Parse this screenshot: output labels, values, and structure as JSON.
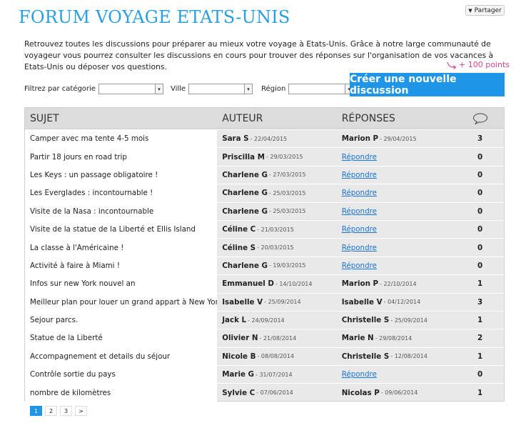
{
  "header": {
    "title": "FORUM VOYAGE ETATS-UNIS",
    "share_label": "Partager"
  },
  "intro": "Retrouvez toutes les discussions pour préparer au mieux votre voyage à Etats-Unis. Grâce à notre large communauté de voyageur vous pourrez consulter les discussions en cours pour trouver des réponses sur l'organisation de vos vacances à Etats-Unis ou déposer vos questions.",
  "points_label": "+ 100 points",
  "create_button": "Créer une nouvelle discussion",
  "filters": {
    "category_label": "Filtrez par catégorie",
    "city_label": "Ville",
    "region_label": "Région"
  },
  "table": {
    "headers": {
      "subject": "SUJET",
      "author": "AUTEUR",
      "replies": "RÉPONSES"
    },
    "rows": [
      {
        "subject": "Camper avec ma tente 4-5 mois",
        "author": "Sara S",
        "author_date": "- 22/04/2015",
        "reply_name": "Marion P",
        "reply_date": "- 29/04/2015",
        "reply_link": "",
        "count": "3"
      },
      {
        "subject": "Partir 18 jours en road trip",
        "author": "Priscilla M",
        "author_date": "- 29/03/2015",
        "reply_name": "",
        "reply_date": "",
        "reply_link": "Répondre",
        "count": "0"
      },
      {
        "subject": "Les Keys : un passage obligatoire !",
        "author": "Charlene G",
        "author_date": "- 27/03/2015",
        "reply_name": "",
        "reply_date": "",
        "reply_link": "Répondre",
        "count": "0"
      },
      {
        "subject": "Les Everglades : incontournable !",
        "author": "Charlene G",
        "author_date": "- 25/03/2015",
        "reply_name": "",
        "reply_date": "",
        "reply_link": "Répondre",
        "count": "0"
      },
      {
        "subject": "Visite de la Nasa : incontournable",
        "author": "Charlene G",
        "author_date": "- 25/03/2015",
        "reply_name": "",
        "reply_date": "",
        "reply_link": "Répondre",
        "count": "0"
      },
      {
        "subject": "Visite de la statue de la Liberté et Ellis Island",
        "author": "Céline C",
        "author_date": "- 21/03/2015",
        "reply_name": "",
        "reply_date": "",
        "reply_link": "Répondre",
        "count": "0"
      },
      {
        "subject": "La classe à l'Américaine !",
        "author": "Céline S",
        "author_date": "- 20/03/2015",
        "reply_name": "",
        "reply_date": "",
        "reply_link": "Répondre",
        "count": "0"
      },
      {
        "subject": "Activité à faire à Miami !",
        "author": "Charlene G",
        "author_date": "- 19/03/2015",
        "reply_name": "",
        "reply_date": "",
        "reply_link": "Répondre",
        "count": "0"
      },
      {
        "subject": "Infos sur new York nouvel an",
        "author": "Emmanuel D",
        "author_date": "- 14/10/2014",
        "reply_name": "Marion P",
        "reply_date": "- 22/10/2014",
        "reply_link": "",
        "count": "1"
      },
      {
        "subject": "Meilleur plan pour louer un grand appart à New York",
        "author": "Isabelle V",
        "author_date": "- 25/09/2014",
        "reply_name": "Isabelle V",
        "reply_date": "- 04/12/2014",
        "reply_link": "",
        "count": "3"
      },
      {
        "subject": "Sejour parcs.",
        "author": "Jack L",
        "author_date": "- 24/09/2014",
        "reply_name": "Christelle S",
        "reply_date": "- 25/09/2014",
        "reply_link": "",
        "count": "1"
      },
      {
        "subject": "Statue de la Liberté",
        "author": "Olivier N",
        "author_date": "- 21/08/2014",
        "reply_name": "Marie N",
        "reply_date": "- 29/08/2014",
        "reply_link": "",
        "count": "2"
      },
      {
        "subject": "Accompagnement et details du séjour",
        "author": "Nicole B",
        "author_date": "- 08/08/2014",
        "reply_name": "Christelle S",
        "reply_date": "- 12/08/2014",
        "reply_link": "",
        "count": "1"
      },
      {
        "subject": "Contrôle sortie du pays",
        "author": "Marie G",
        "author_date": "- 31/07/2014",
        "reply_name": "",
        "reply_date": "",
        "reply_link": "Répondre",
        "count": "0"
      },
      {
        "subject": "nombre de kilomètres",
        "author": "Sylvie C",
        "author_date": "- 07/06/2014",
        "reply_name": "Nicolas P",
        "reply_date": "- 09/06/2014",
        "reply_link": "",
        "count": "1"
      }
    ]
  },
  "pagination": {
    "pages": [
      "1",
      "2",
      "3"
    ],
    "active": "1",
    "next": ">"
  },
  "colors": {
    "title": "#2a9fe0",
    "create_button": "#1e95e6",
    "points": "#d9468e",
    "link": "#1a73d6"
  },
  "icons": {
    "share": "chevron-down-icon",
    "comments": "speech-bubble-icon",
    "points_arrow": "curved-arrow-icon"
  }
}
